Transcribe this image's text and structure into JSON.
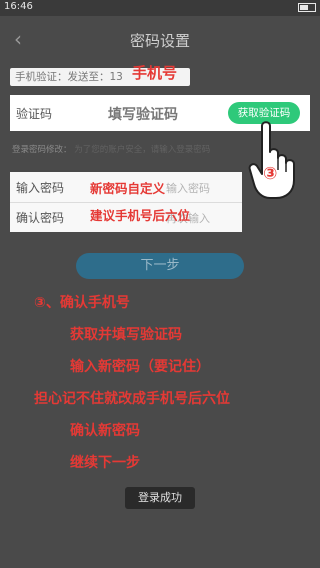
{
  "status_bar": {
    "time": "16:46"
  },
  "header": {
    "title": "密码设置",
    "back_glyph": "‹"
  },
  "phone": {
    "label": "手机验证：发送至：13",
    "annotation": "手机号"
  },
  "verification": {
    "label": "验证码",
    "placeholder": "填写验证码",
    "get_code_button": "获取验证码"
  },
  "hint": {
    "prefix": "登录密码修改：",
    "suffix": "为了您的账户安全，请输入登录密码"
  },
  "password": {
    "new_label": "输入密码",
    "new_placeholder": "输入密码",
    "new_annotation": "新密码自定义",
    "confirm_label": "确认密码",
    "confirm_placeholder": "再次输入",
    "confirm_annotation": "建议手机号后六位"
  },
  "next_button": "下一步",
  "steps": [
    "③、确认手机号",
    "获取并填写验证码",
    "输入新密码（要记住）",
    "担心记不住就改成手机号后六位",
    "确认新密码",
    "继续下一步"
  ],
  "toast": "登录成功",
  "circled_number": "③",
  "colors": {
    "annotation_red": "#e53935",
    "button_green": "#2ec97a",
    "next_button_blue": "#2e6d8b"
  },
  "icons": [
    "back-arrow-icon",
    "battery-icon",
    "pointing-hand-icon"
  ]
}
